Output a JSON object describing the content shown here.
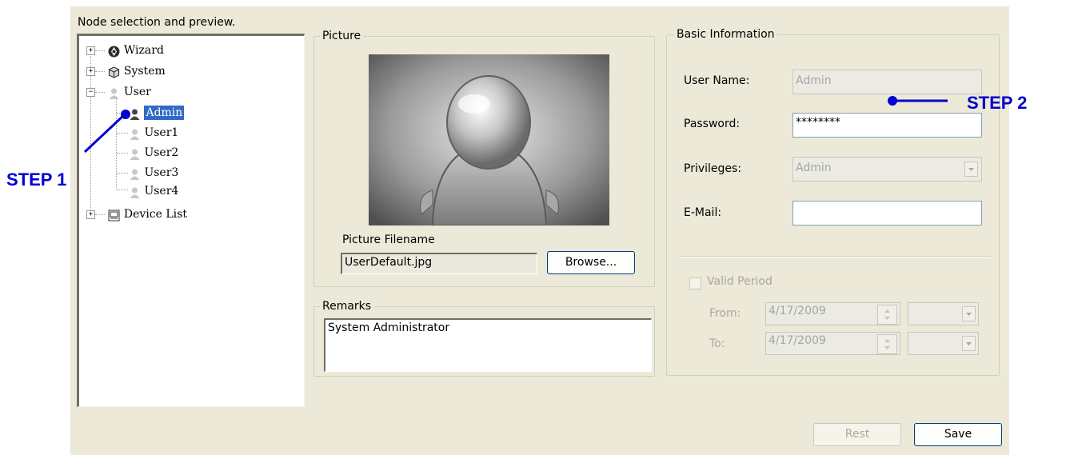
{
  "header": {
    "caption": "Node selection and preview."
  },
  "tree": {
    "wizard": "Wizard",
    "system": "System",
    "user": "User",
    "users": [
      "Admin",
      "User1",
      "User2",
      "User3",
      "User4"
    ],
    "device_list": "Device List",
    "expand_symbols": {
      "plus": "+",
      "minus": "−"
    }
  },
  "picture": {
    "legend": "Picture",
    "filename_label": "Picture Filename",
    "filename_value": "UserDefault.jpg",
    "browse_label": "Browse..."
  },
  "remarks": {
    "legend": "Remarks",
    "value": "System Administrator"
  },
  "basic": {
    "legend": "Basic Information",
    "username_label": "User Name:",
    "username_value": "Admin",
    "password_label": "Password:",
    "password_value": "********",
    "privileges_label": "Privileges:",
    "privileges_value": "Admin",
    "email_label": "E-Mail:",
    "email_value": "",
    "valid_period_label": "Valid Period",
    "from_label": "From:",
    "from_value": "4/17/2009",
    "to_label": "To:",
    "to_value": "4/17/2009"
  },
  "footer": {
    "rest_label": "Rest",
    "save_label": "Save"
  },
  "annotations": {
    "step1": "STEP 1",
    "step2": "STEP 2"
  },
  "colors": {
    "panel": "#ece9d8",
    "selection": "#316ac5",
    "annotation": "#0000d0"
  }
}
